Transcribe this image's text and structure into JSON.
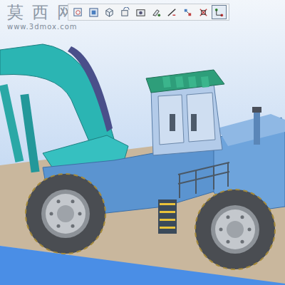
{
  "watermark": {
    "brand": "莫西网",
    "url": "www.3dmox.com"
  },
  "toolbar": {
    "buttons": [
      {
        "selected": false
      },
      {
        "selected": false
      },
      {
        "selected": false
      },
      {
        "selected": false
      },
      {
        "selected": false
      },
      {
        "selected": false
      },
      {
        "selected": false
      },
      {
        "selected": false
      },
      {
        "selected": false
      },
      {
        "selected": true
      }
    ]
  }
}
